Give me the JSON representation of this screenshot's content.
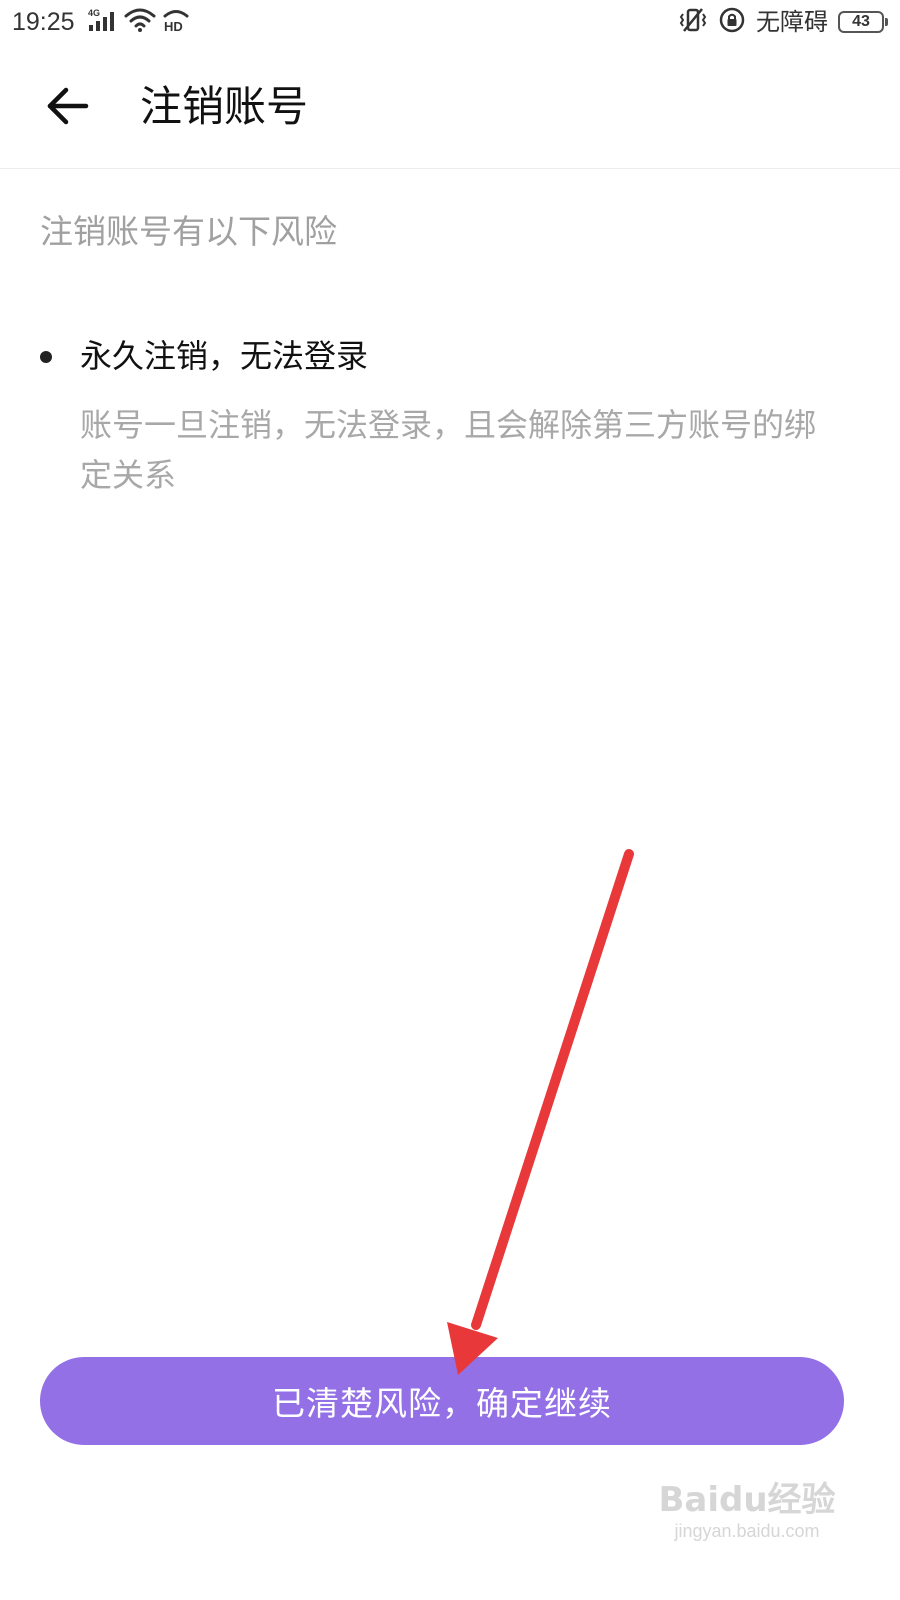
{
  "status_bar": {
    "time": "19:25",
    "network_label": "4G",
    "hd_label": "HD",
    "accessibility_label": "无障碍",
    "battery_level": "43",
    "icons": [
      "signal-icon",
      "wifi-icon",
      "hd-call-icon",
      "vibrate-icon",
      "rotation-lock-icon",
      "battery-icon"
    ]
  },
  "header": {
    "back_icon": "back-arrow-icon",
    "title": "注销账号"
  },
  "content": {
    "intro": "注销账号有以下风险",
    "risks": [
      {
        "title": "永久注销，无法登录",
        "description": "账号一旦注销，无法登录，且会解除第三方账号的绑定关系"
      }
    ]
  },
  "confirm_button": {
    "label": "已清楚风险，确定继续",
    "color": "#9370e6"
  },
  "annotation": {
    "arrow_color": "#e8383a"
  },
  "watermark": {
    "brand": "Baidu经验",
    "url": "jingyan.baidu.com"
  }
}
